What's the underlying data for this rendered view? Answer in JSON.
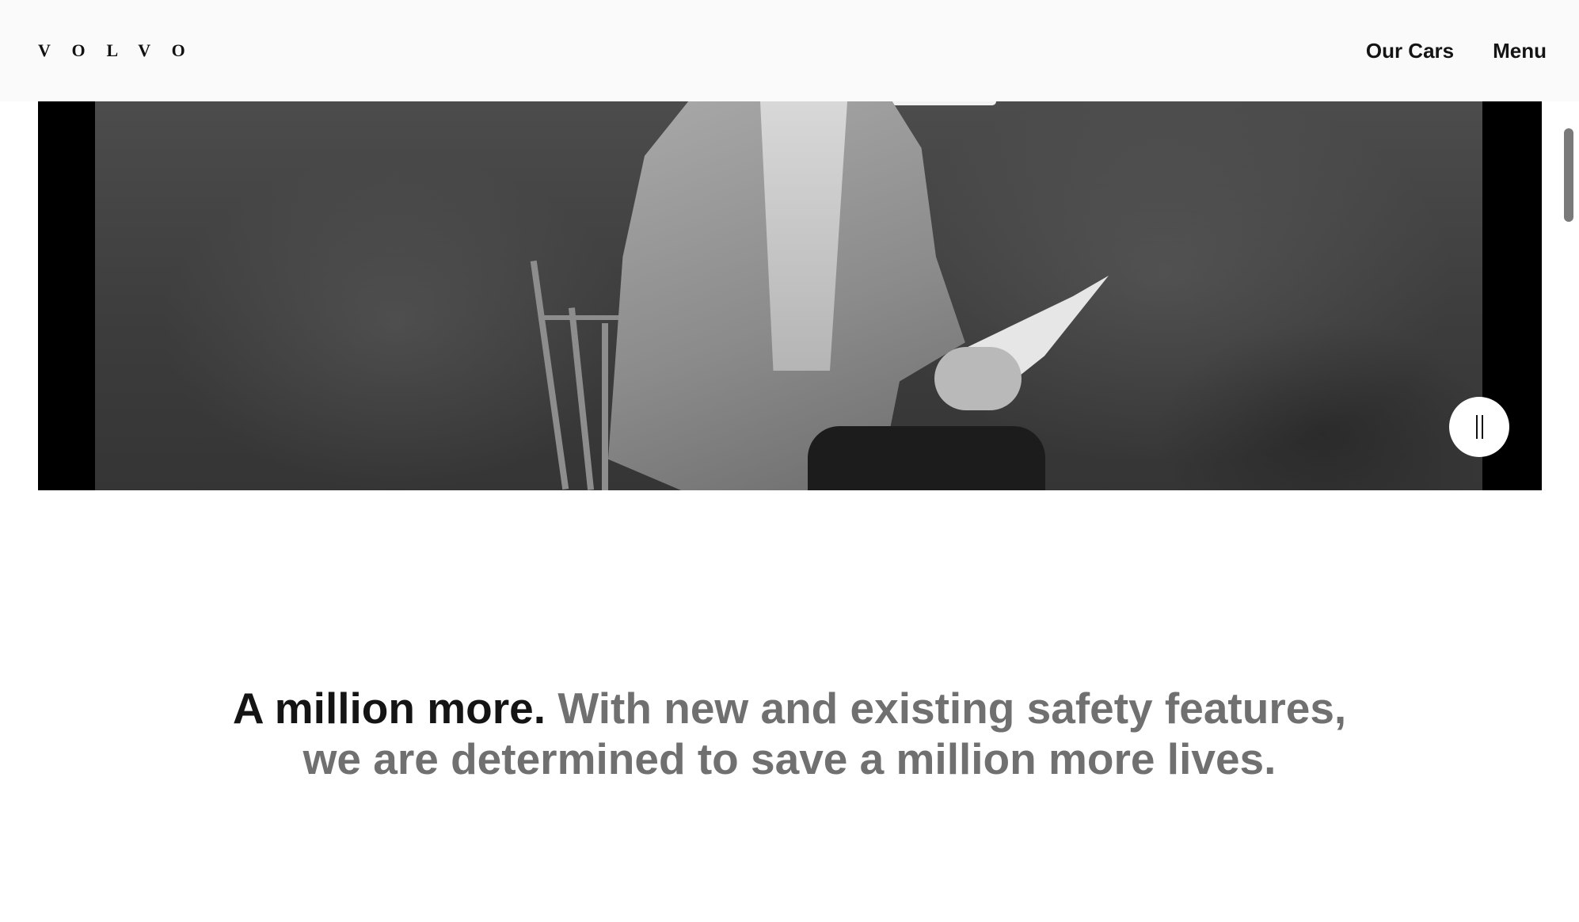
{
  "header": {
    "logo_text": "VOLVO",
    "nav": {
      "our_cars": "Our Cars",
      "menu": "Menu"
    }
  },
  "video": {
    "state": "playing",
    "control_icon": "pause-icon"
  },
  "statement": {
    "lead": "A million more.",
    "body_line1": "With new and existing safety features,",
    "body_line2": "we are determined to save a million more lives."
  },
  "colors": {
    "header_bg": "#fafafa",
    "text_primary": "#141414",
    "text_secondary": "#707070"
  }
}
